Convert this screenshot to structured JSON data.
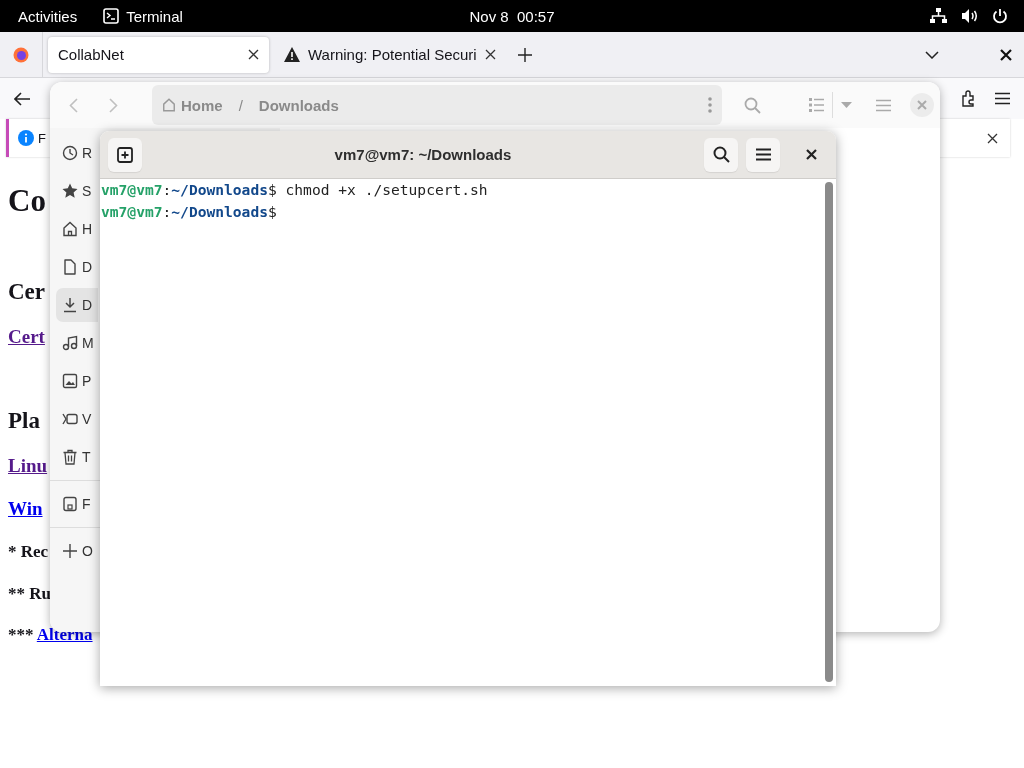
{
  "top_bar": {
    "activities": "Activities",
    "app": "Terminal",
    "clock": "Nov 8  00:57"
  },
  "browser": {
    "tabs": [
      {
        "kind": "page",
        "label": "CollabNet",
        "selected": true
      },
      {
        "kind": "warning",
        "label": "Warning: Potential Securi",
        "selected": false
      }
    ],
    "notification": {
      "text": "F"
    },
    "content": [
      {
        "kind": "heading1",
        "text": "Co"
      },
      {
        "kind": "heading2",
        "text": "Cer"
      },
      {
        "kind": "link",
        "text": "Cert",
        "visited": true
      },
      {
        "kind": "heading2",
        "text": "Pla"
      },
      {
        "kind": "link",
        "text": "Linu",
        "visited": true
      },
      {
        "kind": "link",
        "text": "Win",
        "visited": false
      },
      {
        "kind": "note",
        "text": "* Rec"
      },
      {
        "kind": "note",
        "text": "** Ru"
      },
      {
        "kind": "note_link",
        "prefix": "***",
        "text": "Alterna",
        "visited": false
      }
    ]
  },
  "files": {
    "breadcrumb": [
      "Home",
      "Downloads"
    ],
    "separator": "/",
    "sidebar": [
      {
        "kind": "recent",
        "label": "R",
        "selected": false
      },
      {
        "kind": "starred",
        "label": "S",
        "selected": false
      },
      {
        "kind": "home",
        "label": "H",
        "selected": false
      },
      {
        "kind": "documents",
        "label": "D",
        "selected": false
      },
      {
        "kind": "downloads",
        "label": "D",
        "selected": true
      },
      {
        "kind": "music",
        "label": "M",
        "selected": false
      },
      {
        "kind": "pictures",
        "label": "P",
        "selected": false
      },
      {
        "kind": "videos",
        "label": "V",
        "selected": false
      },
      {
        "kind": "trash",
        "label": "T",
        "selected": false
      },
      {
        "kind": "drive",
        "label": "F",
        "selected": false
      },
      {
        "kind": "other",
        "label": "O",
        "selected": false
      }
    ]
  },
  "terminal": {
    "title": "vm7@vm7: ~/Downloads",
    "lines": [
      {
        "user": "vm7@vm7",
        "colon": ":",
        "path": "~/Downloads",
        "dollar": "$",
        "command": " chmod +x ./setupcert.sh"
      },
      {
        "user": "vm7@vm7",
        "colon": ":",
        "path": "~/Downloads",
        "dollar": "$"
      }
    ]
  }
}
